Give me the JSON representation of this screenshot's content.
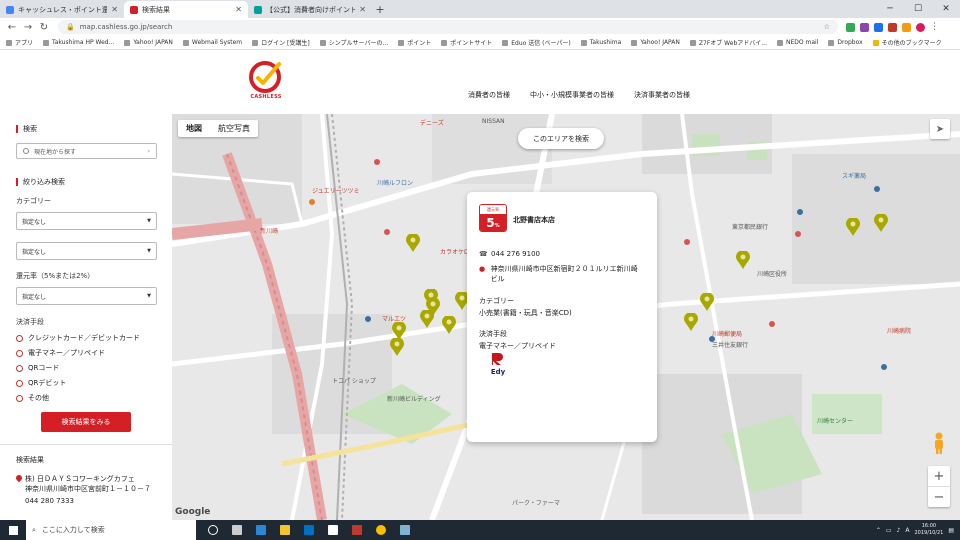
{
  "browser": {
    "tabs": [
      {
        "title": "キャッシュレス・ポイント還元事業",
        "favicon_color": "#4285f4",
        "active": false
      },
      {
        "title": "検索結果",
        "favicon_color": "#d41f26",
        "active": true
      },
      {
        "title": "【公式】消費者向けポイント還元",
        "favicon_color": "#00a0a0",
        "active": false
      }
    ],
    "new_tab": "+",
    "url": "map.cashless.go.jp/search",
    "bookmarks": [
      "アプリ",
      "Takushima HP Wed...",
      "Yahoo! JAPAN",
      "Webmail System",
      "ログイン [受講生]",
      "シンプルサーバーの...",
      "ポイント",
      "ポイントサイト",
      "Eduo 送信 (ベーパー)",
      "Takushima",
      "Yahoo! JAPAN",
      "Z7Fオブ Webアドバイ...",
      "NEDO mail",
      "Dropbox",
      "その他のブックマーク"
    ]
  },
  "site": {
    "logo_text": "CASHLESS",
    "nav": [
      "消費者の皆様",
      "中小・小規模事業者の皆様",
      "決済事業者の皆様"
    ]
  },
  "sidebar": {
    "search_title": "検索",
    "search_placeholder": "現在地から探す",
    "filter_title": "絞り込み検索",
    "category_label": "カテゴリー",
    "category_value": "指定なし",
    "subcategory_value": "指定なし",
    "rate_label": "還元率（5%または2%）",
    "rate_value": "指定なし",
    "payment_label": "決済手段",
    "payments": [
      "クレジットカード／デビットカード",
      "電子マネー／プリペイド",
      "QRコード",
      "QRデビット",
      "その他"
    ],
    "submit": "検索結果をみる",
    "results_title": "検索結果",
    "result": {
      "name": "株) 日ＤＡＹＳコワーキングカフェ",
      "address": "神奈川県川崎市中区宮前町１－１０－７",
      "tel": "044 280 7333"
    }
  },
  "map": {
    "type_map": "地図",
    "type_satellite": "航空写真",
    "search_area": "このエリアを検索",
    "google": "Google",
    "zoom_in": "+",
    "zoom_out": "−",
    "labels": {
      "station": "新川崎",
      "marue": "マルエツ",
      "karaoke": "カラオケDAM",
      "building": "川崎ルフロン",
      "jewel": "ジュエリーツツミ",
      "denny": "デニーズ",
      "tokyu": "トコバ ショップ",
      "nissan": "NISSAN",
      "sugi": "スギ薬局",
      "kawasaki_ward": "川崎区役所",
      "post": "川崎郵便局",
      "tokyo_bank": "東京都民銀行",
      "hospital": "川崎病院",
      "park": "パーク・ファーマ",
      "mitsui": "三井住友銀行",
      "bldg2": "新川崎ビルディング",
      "center": "川崎センター"
    }
  },
  "popup": {
    "badge_top": "還元率",
    "badge_value": "5",
    "badge_unit": "%",
    "shop_name": "北野書店本店",
    "phone": "044 276 9100",
    "address": "神奈川県川崎市中区新宿町２０１ルリエ新川崎ビル",
    "category_label": "カテゴリー",
    "category": "小売業(書籍・玩具・音楽CD)",
    "payment_label": "決済手段",
    "payment": "電子マネー／プリペイド",
    "edy_text": "Edy"
  },
  "taskbar": {
    "search": "ここに入力して検索",
    "time": "16:00",
    "date": "2019/10/21"
  }
}
